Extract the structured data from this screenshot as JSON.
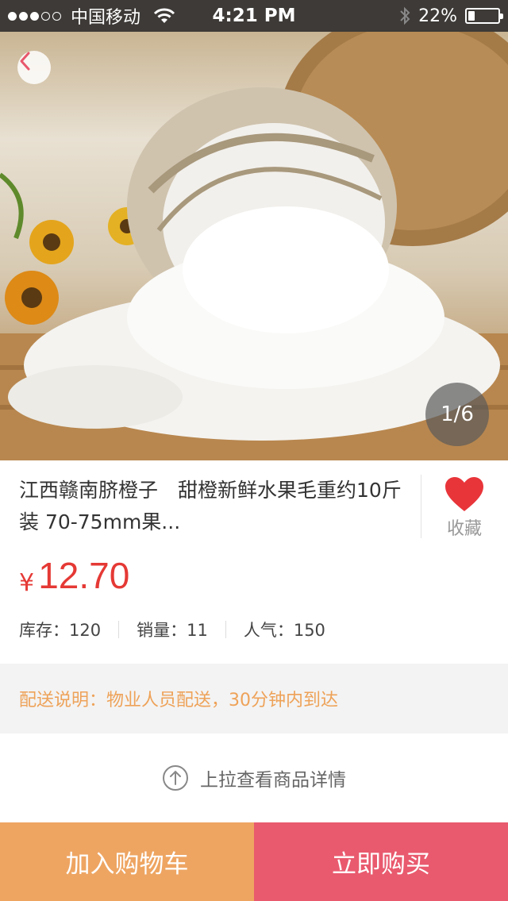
{
  "status_bar": {
    "carrier": "中国移动",
    "time": "4:21 PM",
    "battery": "22%",
    "battery_level": 0.22
  },
  "gallery": {
    "page_indicator": "1/6",
    "current_page": 1,
    "total_pages": 6
  },
  "product": {
    "title": "江西赣南脐橙子　甜橙新鲜水果毛重约10斤装 70-75mm果...",
    "favorite_label": "收藏",
    "currency": "¥",
    "price": "12.70",
    "stats": [
      {
        "label": "库存：",
        "value": "120"
      },
      {
        "label": "销量：",
        "value": "11"
      },
      {
        "label": "人气：",
        "value": "150"
      }
    ]
  },
  "delivery": {
    "text": "配送说明：物业人员配送，30分钟内到达"
  },
  "pullup": {
    "text": "上拉查看商品详情"
  },
  "actions": {
    "add_to_cart": "加入购物车",
    "buy_now": "立即购买"
  },
  "colors": {
    "price": "#e53935",
    "favorite_heart": "#e8353a",
    "delivery_text": "#eea258",
    "cart_button": "#eea562",
    "buy_button": "#e95a6e",
    "status_bar": "#3d3a37"
  }
}
